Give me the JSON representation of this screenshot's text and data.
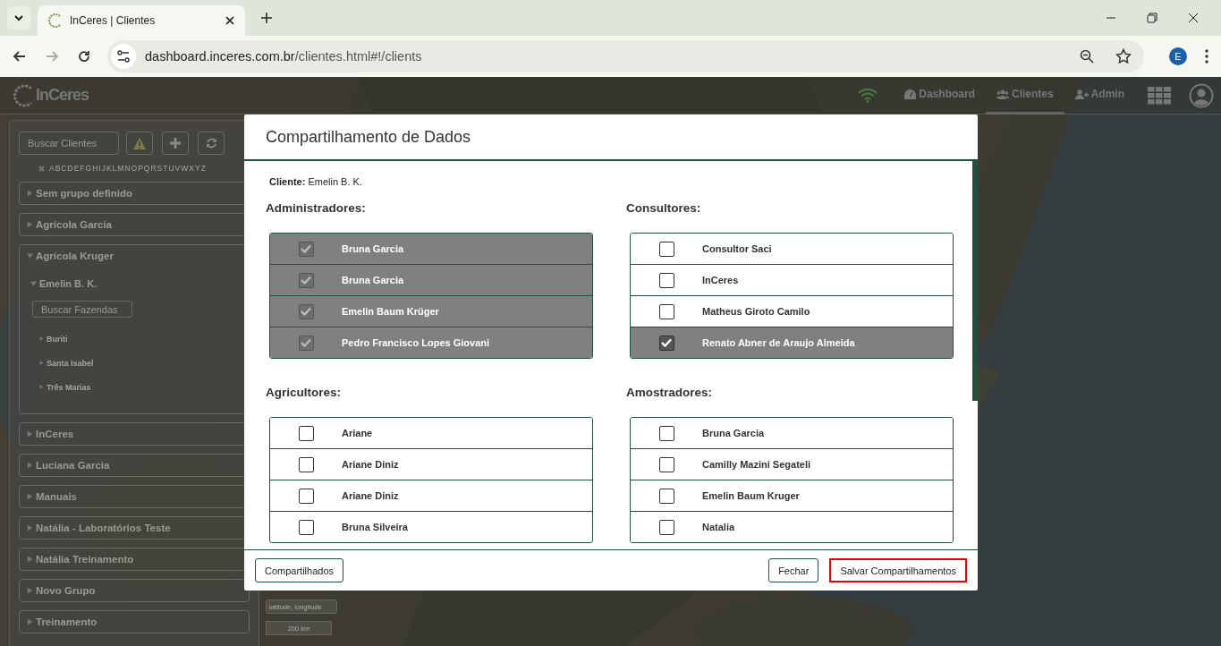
{
  "browser": {
    "tab_title": "InCeres | Clientes",
    "url_host": "dashboard.inceres.com.br",
    "url_path": "/clientes.html#!/clients",
    "profile_initial": "E"
  },
  "navbar": {
    "logo": "InCeres",
    "items": [
      {
        "label": "Dashboard",
        "kind": "dashboard",
        "selected": false
      },
      {
        "label": "Clientes",
        "kind": "clients",
        "selected": true
      },
      {
        "label": "Admin",
        "kind": "admin",
        "selected": false
      }
    ]
  },
  "sidebar": {
    "search_placeholder": "Buscar Clientes",
    "letters": [
      "A",
      "B",
      "C",
      "D",
      "E",
      "F",
      "G",
      "H",
      "I",
      "J",
      "K",
      "L",
      "M",
      "N",
      "O",
      "P",
      "Q",
      "R",
      "S",
      "T",
      "U",
      "V",
      "W",
      "X",
      "Y",
      "Z"
    ],
    "groups": [
      {
        "label": "Sem grupo definido",
        "expanded": false
      },
      {
        "label": "Agrícola Garcia",
        "expanded": false
      },
      {
        "label": "Agrícola Kruger",
        "expanded": true,
        "clients": [
          {
            "label": "Emelin B. K.",
            "expanded": true,
            "search_placeholder": "Buscar Fazendas",
            "farms": [
              {
                "label": "Buriti",
                "expanded": false
              },
              {
                "label": "Santa Isabel",
                "expanded": false
              },
              {
                "label": "Três Marias",
                "expanded": false
              }
            ]
          }
        ]
      },
      {
        "label": "InCeres",
        "expanded": false
      },
      {
        "label": "Luciana Garcia",
        "expanded": false
      },
      {
        "label": "Manuais",
        "expanded": false
      },
      {
        "label": "Natália - Laboratórios Teste",
        "expanded": false
      },
      {
        "label": "Natália Treinamento",
        "expanded": false
      },
      {
        "label": "Novo Grupo",
        "expanded": false
      },
      {
        "label": "Treinamento",
        "expanded": false
      }
    ]
  },
  "map_controls": {
    "coords_placeholder": "latitude, longitude",
    "scale": "200 km"
  },
  "modal": {
    "title": "Compartilhamento de Dados",
    "client": "**Cliente:** Emelin B. K.",
    "sections": [
      {
        "title": "Administradores:",
        "users": [
          {
            "name": "Bruna Garcia",
            "checked": true,
            "disabled": true
          },
          {
            "name": "Bruna Garcia",
            "checked": true,
            "disabled": true
          },
          {
            "name": "Emelin Baum Krüger",
            "checked": true,
            "disabled": true
          },
          {
            "name": "Pedro Francisco Lopes Giovani",
            "checked": true,
            "disabled": true
          }
        ]
      },
      {
        "title": "Consultores:",
        "users": [
          {
            "name": "Consultor Saci",
            "checked": false,
            "disabled": false
          },
          {
            "name": "InCeres",
            "checked": false,
            "disabled": false
          },
          {
            "name": "Matheus Giroto Camilo",
            "checked": false,
            "disabled": false
          },
          {
            "name": "Renato Abner de Araujo Almeida",
            "checked": true,
            "disabled": false
          }
        ]
      },
      {
        "title": "Agricultores:",
        "users": [
          {
            "name": "Ariane",
            "checked": false,
            "disabled": false
          },
          {
            "name": "Ariane Diniz",
            "checked": false,
            "disabled": false
          },
          {
            "name": "Ariane Diniz",
            "checked": false,
            "disabled": false
          },
          {
            "name": "Bruna Silveira",
            "checked": false,
            "disabled": false
          }
        ]
      },
      {
        "title": "Amostradores:",
        "users": [
          {
            "name": "Bruna Garcia",
            "checked": false,
            "disabled": false
          },
          {
            "name": "Camilly Mazini Segateli",
            "checked": false,
            "disabled": false
          },
          {
            "name": "Emelin Baum Kruger",
            "checked": false,
            "disabled": false
          },
          {
            "name": "Natalia",
            "checked": false,
            "disabled": false
          }
        ]
      }
    ],
    "buttons": [
      {
        "label": "Compartilhados",
        "kind": "default"
      },
      {
        "label": "Fechar",
        "kind": "default"
      },
      {
        "label": "Salvar Compartilhamentos",
        "kind": "highlighted"
      }
    ]
  }
}
